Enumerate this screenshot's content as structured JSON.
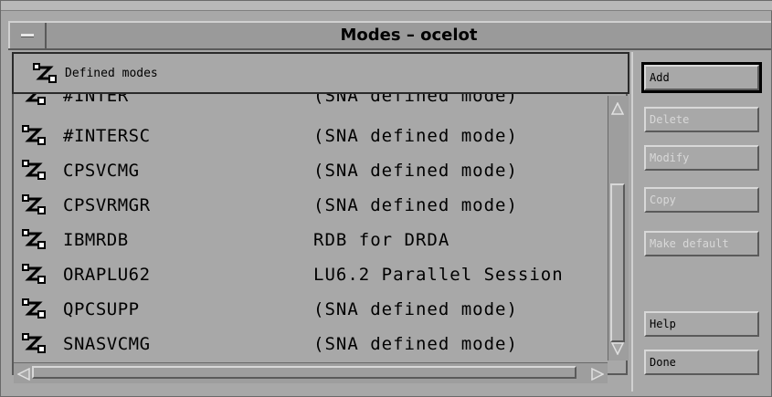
{
  "window": {
    "title": "Modes – ocelot"
  },
  "pane": {
    "header_label": "Defined modes"
  },
  "modes": [
    {
      "name": "#INTER",
      "description": "(SNA defined mode)"
    },
    {
      "name": "#INTERSC",
      "description": "(SNA defined mode)"
    },
    {
      "name": "CPSVCMG",
      "description": "(SNA defined mode)"
    },
    {
      "name": "CPSVRMGR",
      "description": "(SNA defined mode)"
    },
    {
      "name": "IBMRDB",
      "description": "RDB for DRDA"
    },
    {
      "name": "ORAPLU62",
      "description": "LU6.2 Parallel Session"
    },
    {
      "name": "QPCSUPP",
      "description": "(SNA defined mode)"
    },
    {
      "name": "SNASVCMG",
      "description": "(SNA defined mode)"
    }
  ],
  "buttons": {
    "add": "Add",
    "delete": "Delete",
    "modify": "Modify",
    "copy": "Copy",
    "make_default": "Make default",
    "help": "Help",
    "done": "Done"
  },
  "icons": {
    "mode": "mode-icon",
    "sysmenu": "window-menu-icon"
  },
  "colors": {
    "background": "#a8a8a8",
    "text": "#000000",
    "disabled_text": "#d8d8d8"
  }
}
